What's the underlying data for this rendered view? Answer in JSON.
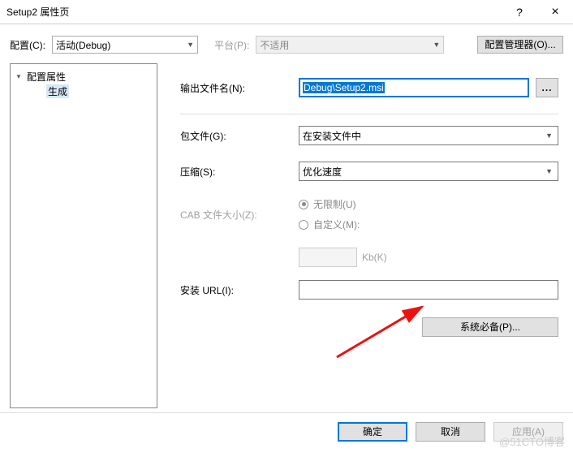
{
  "titlebar": {
    "title": "Setup2 属性页",
    "help": "?",
    "close": "×"
  },
  "toolbar": {
    "config_label": "配置(C):",
    "config_value": "活动(Debug)",
    "platform_label": "平台(P):",
    "platform_value": "不适用",
    "config_manager": "配置管理器(O)..."
  },
  "tree": {
    "root": "配置属性",
    "child": "生成"
  },
  "form": {
    "output_label": "输出文件名(N):",
    "output_value": "Debug\\Setup2.msi",
    "browse": "...",
    "package_label": "包文件(G):",
    "package_value": "在安装文件中",
    "compress_label": "压缩(S):",
    "compress_value": "优化速度",
    "cab_label": "CAB 文件大小(Z):",
    "cab_unlimited": "无限制(U)",
    "cab_custom": "自定义(M):",
    "kb_label": "Kb(K)",
    "install_url_label": "安装 URL(I):",
    "prereq": "系统必备(P)..."
  },
  "footer": {
    "ok": "确定",
    "cancel": "取消",
    "apply": "应用(A)"
  },
  "watermark": "@51CTO博客"
}
